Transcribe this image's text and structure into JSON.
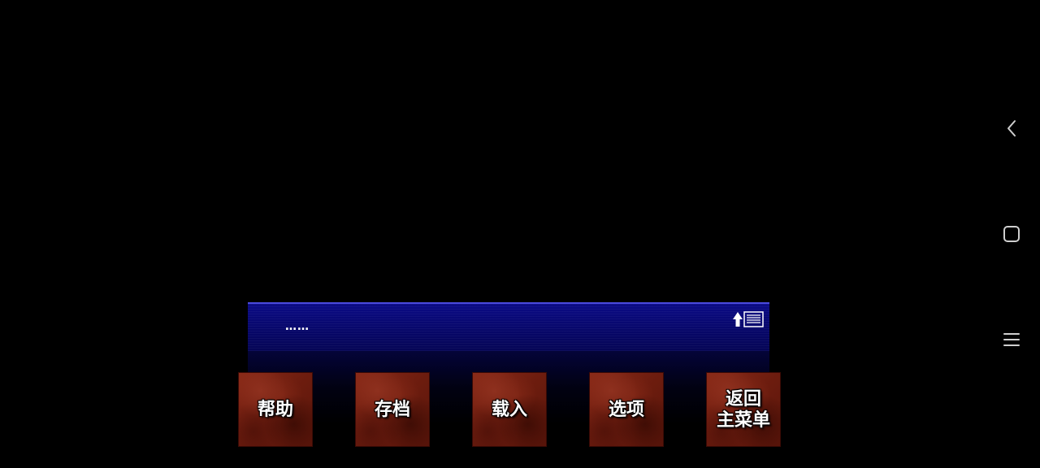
{
  "dialog": {
    "text": "……",
    "backlog_icon": "backlog-arrow-icon"
  },
  "menu": {
    "help": "帮助",
    "save": "存档",
    "load": "载入",
    "options": "选项",
    "return_main": "返回\n主菜单"
  },
  "colors": {
    "dialog_bg": "#07076a",
    "dialog_border": "#4a4adf",
    "button_bg": "#6e1d0f",
    "nav_icon": "#cfcfcf"
  },
  "nav_bar": {
    "icons": [
      "back-chevron-icon",
      "home-square-icon",
      "recent-apps-icon"
    ]
  }
}
